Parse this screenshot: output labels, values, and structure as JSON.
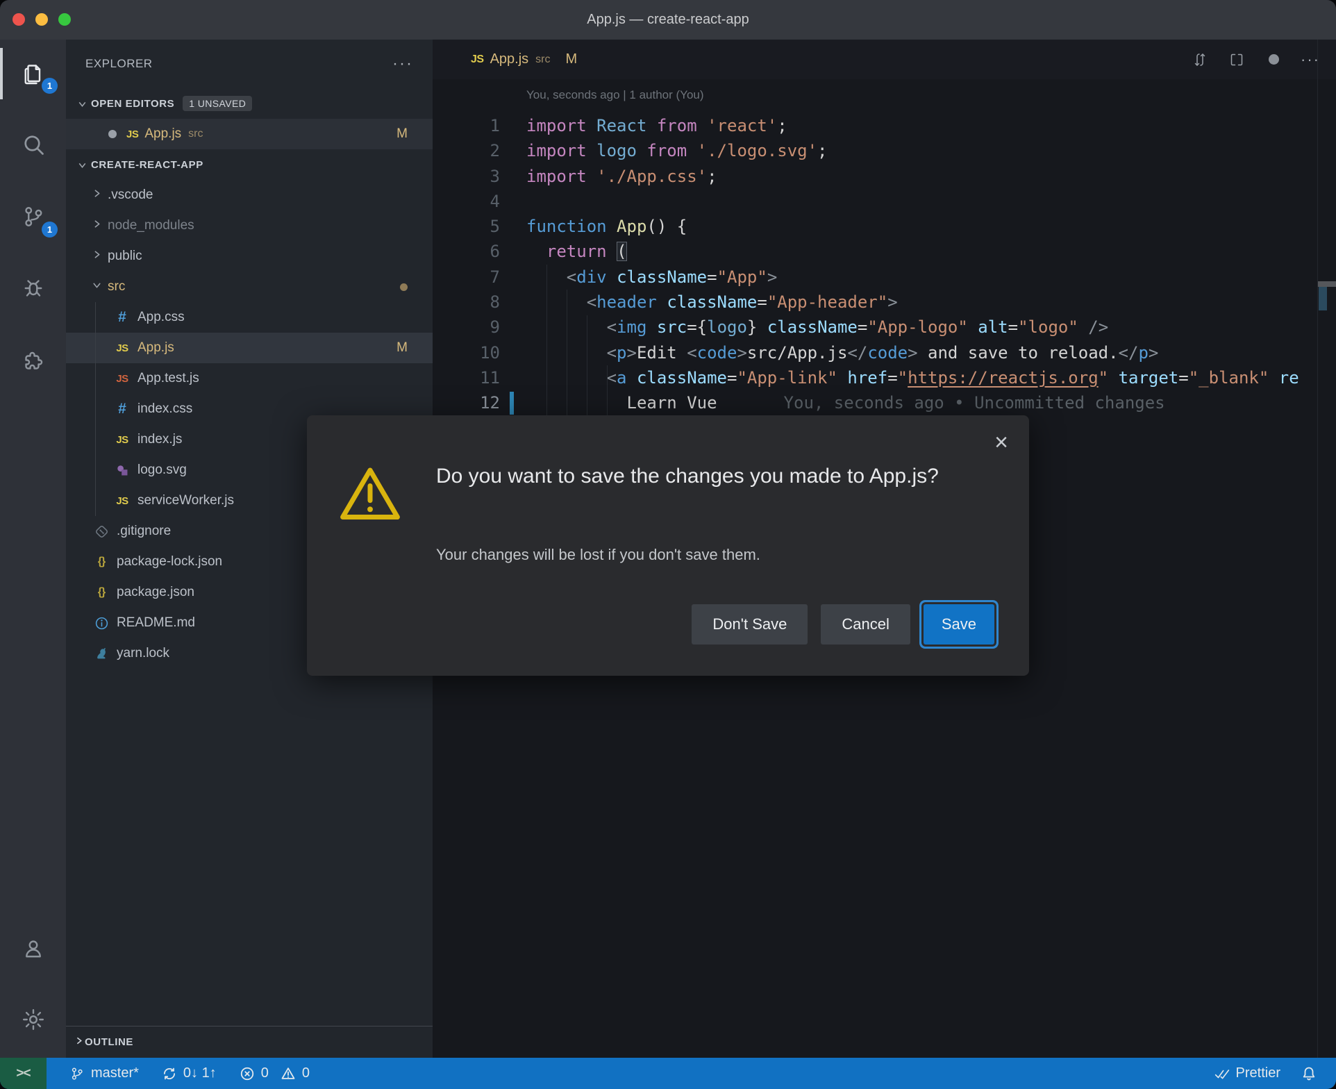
{
  "window": {
    "title": "App.js — create-react-app"
  },
  "colors": {
    "status_blue": "#1171c2",
    "remote_green": "#1a5c43",
    "badge_blue": "#1f77d2",
    "git_modified_gold": "#d7ba7d",
    "warning_yellow": "#d9b40e",
    "save_button_blue": "#1173c5"
  },
  "activity_bar": {
    "items": [
      {
        "name": "explorer",
        "icon": "files-icon",
        "active": true,
        "badge": "1"
      },
      {
        "name": "search",
        "icon": "search-icon"
      },
      {
        "name": "source-control",
        "icon": "git-branch-icon",
        "badge": "1"
      },
      {
        "name": "debug",
        "icon": "bug-icon"
      },
      {
        "name": "extensions",
        "icon": "puzzle-icon"
      }
    ],
    "bottom_items": [
      {
        "name": "account",
        "icon": "person-icon"
      },
      {
        "name": "settings",
        "icon": "gear-icon"
      }
    ]
  },
  "sidebar": {
    "title": "EXPLORER",
    "title_actions": "···",
    "open_editors": {
      "label": "OPEN EDITORS",
      "badge": "1 UNSAVED",
      "items": [
        {
          "name": "App.js",
          "detail": "src",
          "icon": "js-file-icon",
          "git": "M",
          "dirty": true
        }
      ]
    },
    "section_label": "CREATE-REACT-APP",
    "tree": [
      {
        "label": ".vscode",
        "type": "folder",
        "state": "collapsed"
      },
      {
        "label": "node_modules",
        "type": "folder",
        "state": "collapsed",
        "dim": true
      },
      {
        "label": "public",
        "type": "folder",
        "state": "collapsed"
      },
      {
        "label": "src",
        "type": "folder",
        "state": "expanded",
        "gold": true,
        "modified_dot": true
      },
      {
        "label": "App.css",
        "icon": "css-file-icon",
        "child": true
      },
      {
        "label": "App.js",
        "icon": "js-file-icon",
        "child": true,
        "gold": true,
        "selected": true,
        "git": "M"
      },
      {
        "label": "App.test.js",
        "icon": "js-test-file-icon",
        "child": true
      },
      {
        "label": "index.css",
        "icon": "css-file-icon",
        "child": true
      },
      {
        "label": "index.js",
        "icon": "js-file-icon",
        "child": true
      },
      {
        "label": "logo.svg",
        "icon": "svg-file-icon",
        "child": true
      },
      {
        "label": "serviceWorker.js",
        "icon": "js-file-icon",
        "child": true
      },
      {
        "label": ".gitignore",
        "icon": "git-file-icon"
      },
      {
        "label": "package-lock.json",
        "icon": "json-file-icon"
      },
      {
        "label": "package.json",
        "icon": "json-file-icon"
      },
      {
        "label": "README.md",
        "icon": "info-file-icon"
      },
      {
        "label": "yarn.lock",
        "icon": "yarn-file-icon"
      }
    ],
    "outline_label": "OUTLINE"
  },
  "editor": {
    "tab": {
      "icon": "js-file-icon",
      "icon_text": "JS",
      "name": "App.js",
      "detail": "src",
      "git": "M"
    },
    "tab_actions": [
      "compare-changes-icon",
      "split-editor-icon",
      "modified-circle-icon",
      "more-actions-icon"
    ],
    "codelens": "You, seconds ago | 1 author (You)",
    "lines": [
      {
        "n": "1",
        "t": [
          [
            "k",
            "import"
          ],
          [
            "pl",
            " "
          ],
          [
            "id",
            "React"
          ],
          [
            "pl",
            " "
          ],
          [
            "k",
            "from"
          ],
          [
            "pl",
            " "
          ],
          [
            "st",
            "'react'"
          ],
          [
            "pl",
            ";"
          ]
        ]
      },
      {
        "n": "2",
        "t": [
          [
            "k",
            "import"
          ],
          [
            "pl",
            " "
          ],
          [
            "id",
            "logo"
          ],
          [
            "pl",
            " "
          ],
          [
            "k",
            "from"
          ],
          [
            "pl",
            " "
          ],
          [
            "st",
            "'./logo.svg'"
          ],
          [
            "pl",
            ";"
          ]
        ]
      },
      {
        "n": "3",
        "t": [
          [
            "k",
            "import"
          ],
          [
            "pl",
            " "
          ],
          [
            "st",
            "'./App.css'"
          ],
          [
            "pl",
            ";"
          ]
        ]
      },
      {
        "n": "4",
        "t": []
      },
      {
        "n": "5",
        "t": [
          [
            "kb",
            "function"
          ],
          [
            "pl",
            " "
          ],
          [
            "fn",
            "App"
          ],
          [
            "pl",
            "() {"
          ]
        ]
      },
      {
        "n": "6",
        "t": [
          [
            "pl",
            "  "
          ],
          [
            "k",
            "return"
          ],
          [
            "pl",
            " "
          ],
          [
            "brk",
            "("
          ]
        ]
      },
      {
        "n": "7",
        "t": [
          [
            "pl",
            "    "
          ],
          [
            "br",
            "<"
          ],
          [
            "tg",
            "div"
          ],
          [
            "pl",
            " "
          ],
          [
            "at",
            "className"
          ],
          [
            "pl",
            "="
          ],
          [
            "st",
            "\"App\""
          ],
          [
            "br",
            ">"
          ]
        ]
      },
      {
        "n": "8",
        "t": [
          [
            "pl",
            "      "
          ],
          [
            "br",
            "<"
          ],
          [
            "tg",
            "header"
          ],
          [
            "pl",
            " "
          ],
          [
            "at",
            "className"
          ],
          [
            "pl",
            "="
          ],
          [
            "st",
            "\"App-header\""
          ],
          [
            "br",
            ">"
          ]
        ]
      },
      {
        "n": "9",
        "t": [
          [
            "pl",
            "        "
          ],
          [
            "br",
            "<"
          ],
          [
            "tg",
            "img"
          ],
          [
            "pl",
            " "
          ],
          [
            "at",
            "src"
          ],
          [
            "pl",
            "={"
          ],
          [
            "id",
            "logo"
          ],
          [
            "pl",
            "} "
          ],
          [
            "at",
            "className"
          ],
          [
            "pl",
            "="
          ],
          [
            "st",
            "\"App-logo\""
          ],
          [
            "pl",
            " "
          ],
          [
            "at",
            "alt"
          ],
          [
            "pl",
            "="
          ],
          [
            "st",
            "\"logo\""
          ],
          [
            "pl",
            " "
          ],
          [
            "br",
            "/>"
          ]
        ]
      },
      {
        "n": "10",
        "t": [
          [
            "pl",
            "        "
          ],
          [
            "br",
            "<"
          ],
          [
            "tg",
            "p"
          ],
          [
            "br",
            ">"
          ],
          [
            "pl",
            "Edit "
          ],
          [
            "br",
            "<"
          ],
          [
            "tg",
            "code"
          ],
          [
            "br",
            ">"
          ],
          [
            "pl",
            "src/App.js"
          ],
          [
            "br",
            "</"
          ],
          [
            "tg",
            "code"
          ],
          [
            "br",
            ">"
          ],
          [
            "pl",
            " and save to reload."
          ],
          [
            "br",
            "</"
          ],
          [
            "tg",
            "p"
          ],
          [
            "br",
            ">"
          ]
        ]
      },
      {
        "n": "11",
        "t": [
          [
            "pl",
            "        "
          ],
          [
            "br",
            "<"
          ],
          [
            "tg",
            "a"
          ],
          [
            "pl",
            " "
          ],
          [
            "at",
            "className"
          ],
          [
            "pl",
            "="
          ],
          [
            "st",
            "\"App-link\""
          ],
          [
            "pl",
            " "
          ],
          [
            "at",
            "href"
          ],
          [
            "pl",
            "="
          ],
          [
            "st",
            "\""
          ],
          [
            "us",
            "https://reactjs.org"
          ],
          [
            "st",
            "\""
          ],
          [
            "pl",
            " "
          ],
          [
            "at",
            "target"
          ],
          [
            "pl",
            "="
          ],
          [
            "st",
            "\"_blank\""
          ],
          [
            "pl",
            " "
          ],
          [
            "at",
            "re"
          ]
        ]
      },
      {
        "n": "12",
        "t": [
          [
            "pl",
            "          Learn Vue"
          ]
        ],
        "git_modified": true,
        "current": true,
        "blame": "You, seconds ago • Uncommitted changes"
      }
    ]
  },
  "dialog": {
    "close_icon": "×",
    "icon": "warning-triangle-icon",
    "title": "Do you want to save the changes you made to App.js?",
    "body": "Your changes will be lost if you don't save them.",
    "buttons": [
      {
        "label": "Don't Save"
      },
      {
        "label": "Cancel"
      },
      {
        "label": "Save",
        "primary": true
      }
    ]
  },
  "status_bar": {
    "remote": {
      "icon": "remote-icon",
      "label": "><"
    },
    "left_items": [
      {
        "icon": "git-branch-icon",
        "label": "master*"
      },
      {
        "icon": "sync-icon",
        "label": "0↓ 1↑"
      },
      {
        "icon": "errors-warnings-icon",
        "label": "0",
        "label2": "0"
      }
    ],
    "right_items": [
      {
        "icon": "double-check-icon",
        "label": "Prettier"
      },
      {
        "icon": "bell-icon",
        "label": ""
      }
    ]
  }
}
